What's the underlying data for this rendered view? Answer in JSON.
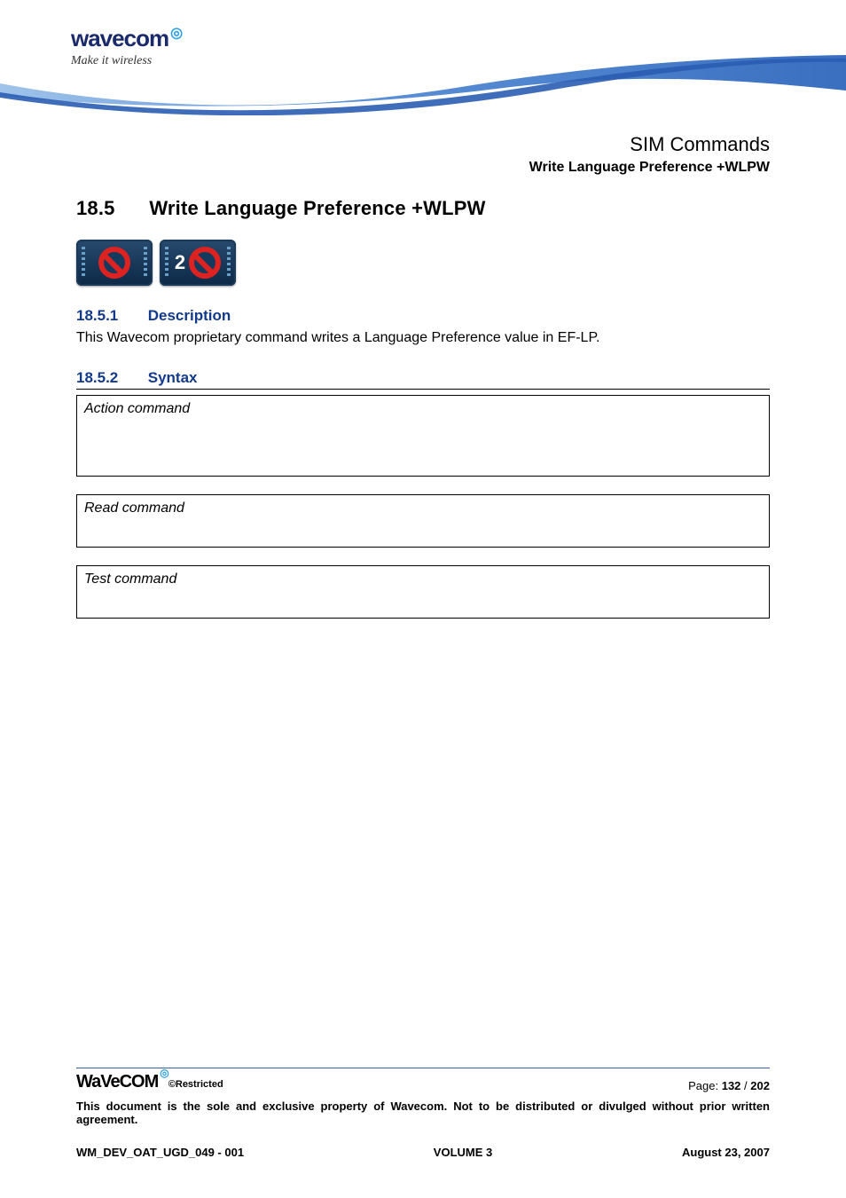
{
  "brand": {
    "name": "wavecom",
    "tagline": "Make it wireless"
  },
  "header_right": {
    "line1": "SIM Commands",
    "line2": "Write Language Preference +WLPW"
  },
  "section": {
    "num": "18.5",
    "title": "Write Language Preference +WLPW"
  },
  "icons": {
    "first": "prohibit-icon",
    "second_number": "2",
    "second": "prohibit-icon"
  },
  "sub1": {
    "num": "18.5.1",
    "title": "Description",
    "text": "This Wavecom proprietary command writes a Language Preference value in EF-LP."
  },
  "sub2": {
    "num": "18.5.2",
    "title": "Syntax"
  },
  "cmdboxes": {
    "action": "Action command",
    "read": "Read command",
    "test": "Test command"
  },
  "footer": {
    "logo": "WaVeCOM",
    "restricted_prefix": "©",
    "restricted": "Restricted",
    "page_label": "Page:",
    "page_current": "132",
    "page_sep": "/",
    "page_total": "202",
    "disclaimer": "This document is the sole and exclusive property of Wavecom. Not to be distributed or divulged without prior written agreement.",
    "docid": "WM_DEV_OAT_UGD_049 - 001",
    "volume": "VOLUME 3",
    "date": "August 23, 2007"
  }
}
